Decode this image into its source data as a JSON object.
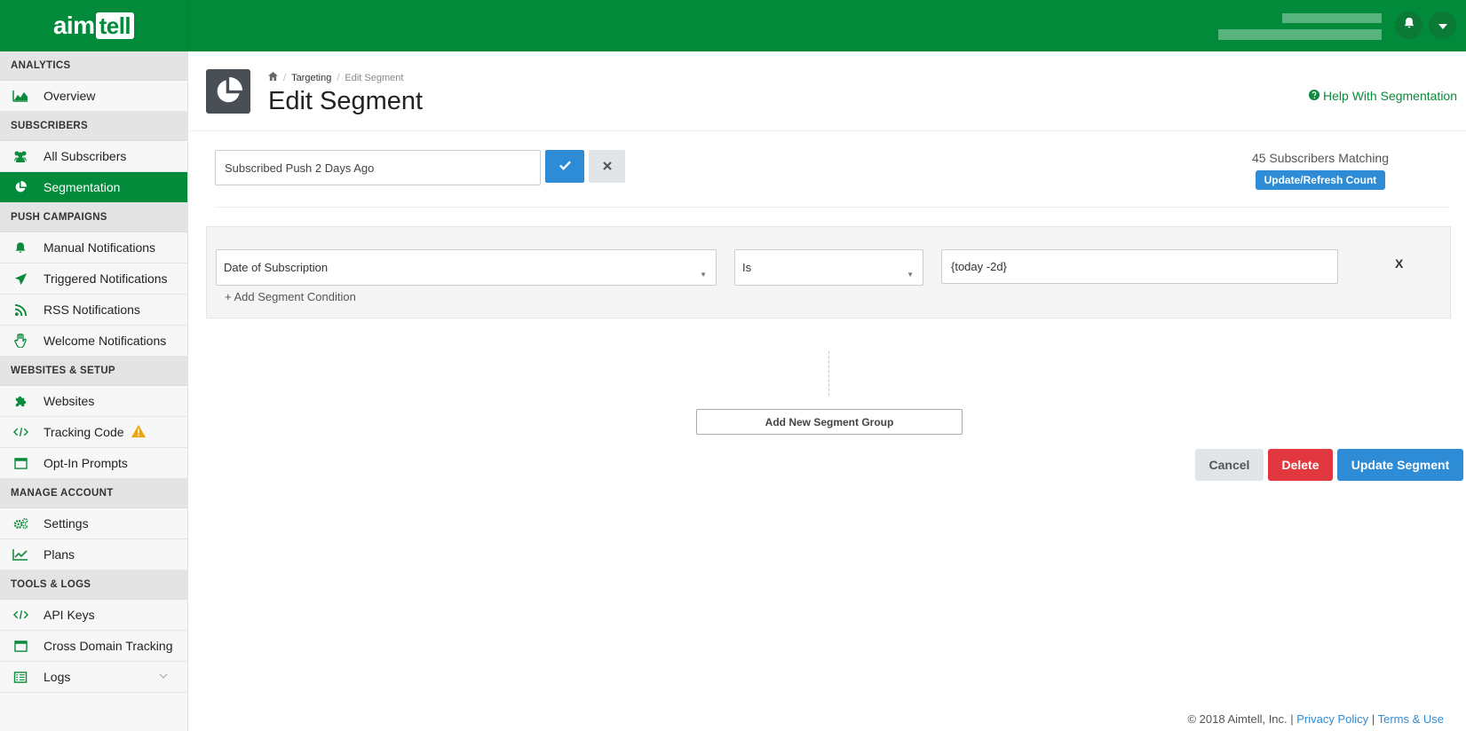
{
  "brand": {
    "logo_text_1": "aim",
    "logo_text_2": "tell",
    "accent_color": "#008a3a"
  },
  "topbar": {
    "icons": [
      "bell-icon",
      "caret-down-icon"
    ]
  },
  "sidebar": {
    "sections": [
      {
        "header": "ANALYTICS",
        "items": [
          {
            "label": "Overview",
            "icon": "area-chart-icon"
          }
        ]
      },
      {
        "header": "SUBSCRIBERS",
        "items": [
          {
            "label": "All Subscribers",
            "icon": "users-icon"
          },
          {
            "label": "Segmentation",
            "icon": "pie-chart-icon",
            "active": true
          }
        ]
      },
      {
        "header": "PUSH CAMPAIGNS",
        "items": [
          {
            "label": "Manual Notifications",
            "icon": "bell-icon"
          },
          {
            "label": "Triggered Notifications",
            "icon": "paper-plane-icon"
          },
          {
            "label": "RSS Notifications",
            "icon": "rss-icon"
          },
          {
            "label": "Welcome Notifications",
            "icon": "hand-wave-icon"
          }
        ]
      },
      {
        "header": "WEBSITES & SETUP",
        "items": [
          {
            "label": "Websites",
            "icon": "puzzle-icon"
          },
          {
            "label": "Tracking Code",
            "icon": "code-icon",
            "warning": true
          },
          {
            "label": "Opt-In Prompts",
            "icon": "window-icon"
          }
        ]
      },
      {
        "header": "MANAGE ACCOUNT",
        "items": [
          {
            "label": "Settings",
            "icon": "gears-icon"
          },
          {
            "label": "Plans",
            "icon": "line-chart-icon"
          }
        ]
      },
      {
        "header": "TOOLS & LOGS",
        "items": [
          {
            "label": "API Keys",
            "icon": "code-icon"
          },
          {
            "label": "Cross Domain Tracking",
            "icon": "window-icon"
          },
          {
            "label": "Logs",
            "icon": "list-icon",
            "chevron": true
          }
        ]
      }
    ]
  },
  "header": {
    "breadcrumb": {
      "home_icon": "home-icon",
      "parent": "Targeting",
      "current": "Edit Segment"
    },
    "title": "Edit Segment",
    "help_link": "Help With Segmentation"
  },
  "segment": {
    "name_value": "Subscribed Push 2 Days Ago",
    "matching_text": "45 Subscribers Matching",
    "refresh_label": "Update/Refresh Count"
  },
  "condition": {
    "field": "Date of Subscription",
    "operator": "Is",
    "value": "{today -2d}",
    "remove_label": "X",
    "add_condition_label": "+ Add Segment Condition"
  },
  "add_group_label": "Add New Segment Group",
  "actions": {
    "cancel": "Cancel",
    "delete": "Delete",
    "update": "Update Segment"
  },
  "footer": {
    "copyright": "© 2018 Aimtell, Inc. |",
    "privacy": "Privacy Policy",
    "sep": "|",
    "terms": "Terms & Use"
  }
}
